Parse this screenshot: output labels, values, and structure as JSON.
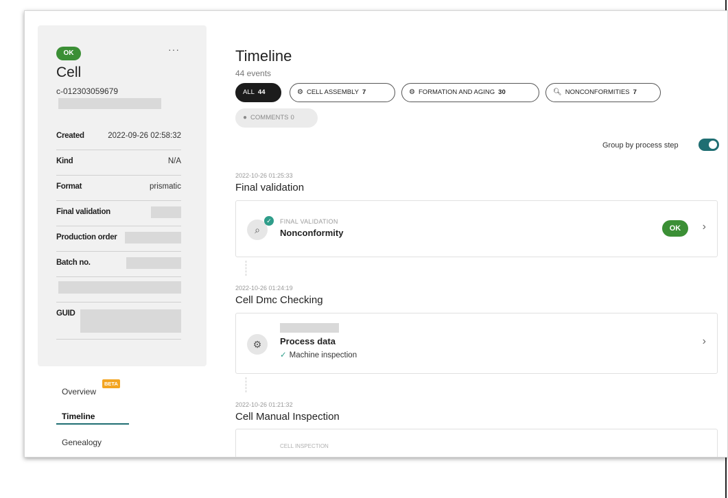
{
  "cell": {
    "status": "OK",
    "more": "···",
    "title": "Cell",
    "id": "c-012303059679",
    "meta": [
      {
        "key": "Created",
        "value": "2022-09-26 02:58:32"
      },
      {
        "key": "Kind",
        "value": "N/A"
      },
      {
        "key": "Format",
        "value": "prismatic"
      },
      {
        "key": "Final validation",
        "value": ""
      },
      {
        "key": "Production order",
        "value": ""
      },
      {
        "key": "Batch no.",
        "value": ""
      },
      {
        "key": "",
        "value": ""
      },
      {
        "key": "GUID",
        "value": ""
      }
    ]
  },
  "nav": {
    "overview": "Overview",
    "beta": "BETA",
    "timeline": "Timeline",
    "genealogy": "Genealogy",
    "active": "timeline"
  },
  "timeline": {
    "title": "Timeline",
    "count": "44 events",
    "filters": [
      {
        "label": "ALL",
        "count": "44",
        "active": true,
        "icon": ""
      },
      {
        "label": "CELL ASSEMBLY",
        "count": "7",
        "active": false,
        "icon": "gears-icon"
      },
      {
        "label": "FORMATION AND AGING",
        "count": "30",
        "active": false,
        "icon": "gears-icon"
      },
      {
        "label": "NONCONFORMITIES",
        "count": "7",
        "active": false,
        "icon": "search-icon"
      },
      {
        "label": "COMMENTS",
        "count": "0",
        "active": false,
        "icon": "comment-icon"
      }
    ],
    "group_label": "Group by process step",
    "group_enabled": true,
    "events": [
      {
        "time": "2022-10-26 01:25:33",
        "step": "Final validation",
        "category": "FINAL VALIDATION",
        "name": "Nonconformity",
        "status": "OK"
      },
      {
        "time": "2022-10-26 01:24:19",
        "step": "Cell Dmc Checking",
        "name": "Process data",
        "detail": "Machine inspection"
      },
      {
        "time": "2022-10-26 01:21:32",
        "step": "Cell Manual Inspection",
        "category": "CELL INSPECTION"
      }
    ]
  },
  "colors": {
    "accent": "#1f6e72",
    "ok": "#3b8f35",
    "check": "#2f9d8a",
    "beta": "#f3a521"
  }
}
